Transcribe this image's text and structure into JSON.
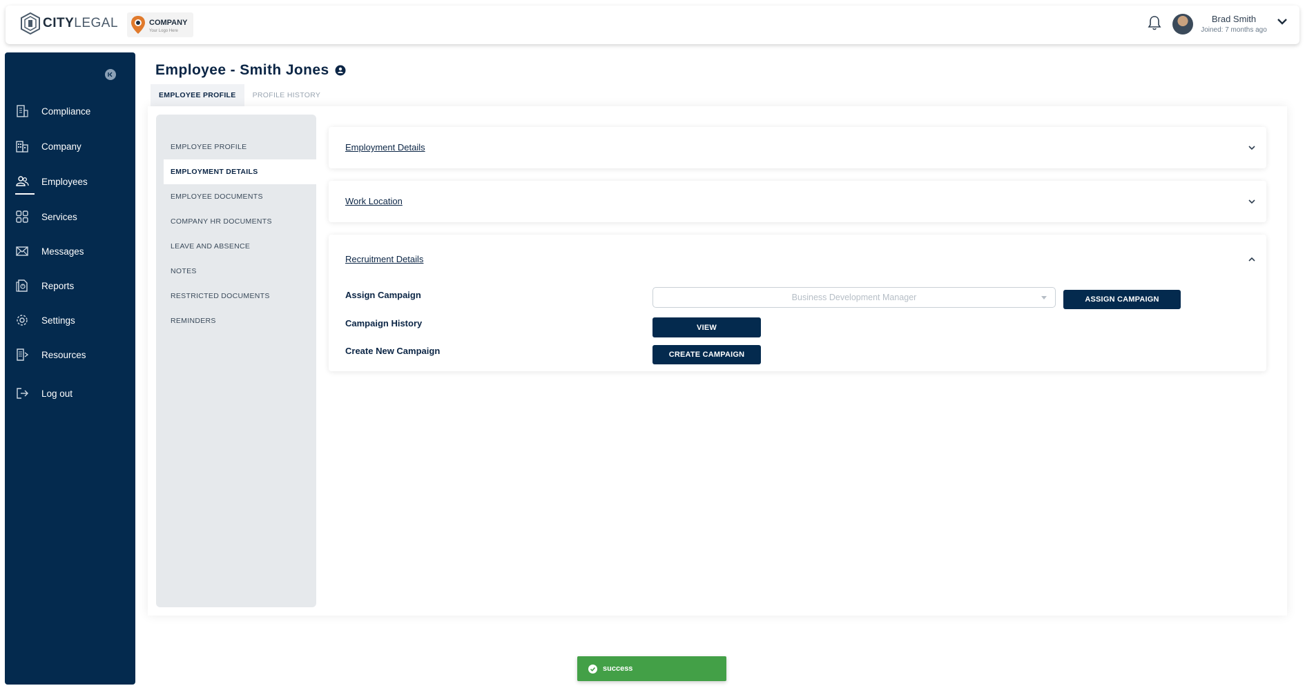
{
  "header": {
    "brand_bold": "CITY",
    "brand_light": "LEGAL",
    "company_name": "COMPANY",
    "company_tagline": "Your Logo Here",
    "user_name": "Brad Smith",
    "user_joined": "Joined: 7 months ago"
  },
  "sidebar": {
    "items": [
      {
        "label": "Compliance",
        "icon": "compliance-icon"
      },
      {
        "label": "Company",
        "icon": "building-icon"
      },
      {
        "label": "Employees",
        "icon": "users-icon",
        "active": true
      },
      {
        "label": "Services",
        "icon": "grid-icon"
      },
      {
        "label": "Messages",
        "icon": "mail-icon"
      },
      {
        "label": "Reports",
        "icon": "report-icon"
      },
      {
        "label": "Settings",
        "icon": "gear-icon"
      },
      {
        "label": "Resources",
        "icon": "resources-icon"
      },
      {
        "label": "Log out",
        "icon": "logout-icon"
      }
    ]
  },
  "page": {
    "title": "Employee - Smith Jones",
    "tabs": [
      {
        "label": "EMPLOYEE PROFILE",
        "active": true
      },
      {
        "label": "PROFILE HISTORY",
        "active": false
      }
    ]
  },
  "subnav": {
    "items": [
      {
        "label": "EMPLOYEE PROFILE"
      },
      {
        "label": "EMPLOYMENT DETAILS",
        "active": true
      },
      {
        "label": "EMPLOYEE DOCUMENTS"
      },
      {
        "label": "COMPANY HR DOCUMENTS"
      },
      {
        "label": "LEAVE AND ABSENCE"
      },
      {
        "label": "NOTES"
      },
      {
        "label": "RESTRICTED DOCUMENTS"
      },
      {
        "label": "REMINDERS"
      }
    ]
  },
  "sections": {
    "employment": {
      "title": "Employment Details",
      "expanded": false
    },
    "work_location": {
      "title": "Work Location",
      "expanded": false
    },
    "recruitment": {
      "title": "Recruitment Details",
      "expanded": true,
      "assign_label": "Assign Campaign",
      "campaign_select_value": "Business Development Manager",
      "assign_button": "ASSIGN CAMPAIGN",
      "history_label": "Campaign History",
      "view_button": "VIEW",
      "create_label": "Create New Campaign",
      "create_button": "CREATE CAMPAIGN"
    }
  },
  "toast": {
    "message": "success",
    "color": "#43a047"
  },
  "colors": {
    "primary": "#042a4e",
    "success": "#43a047"
  }
}
